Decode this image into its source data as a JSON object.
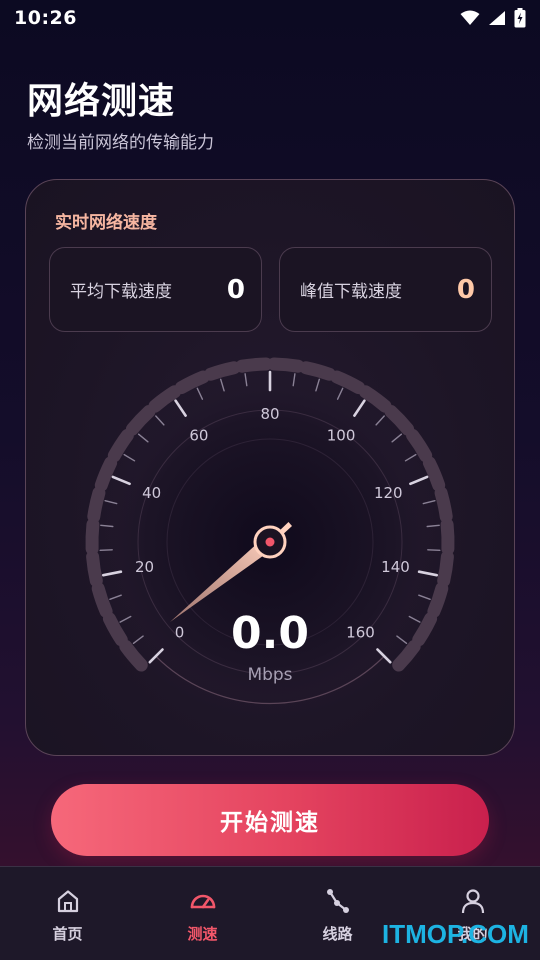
{
  "status_bar": {
    "time": "10:26",
    "icons": [
      "wifi-icon",
      "cell-signal-icon",
      "battery-charging-icon"
    ]
  },
  "header": {
    "title": "网络测速",
    "subtitle": "检测当前网络的传输能力"
  },
  "card": {
    "title": "实时网络速度",
    "avg": {
      "label": "平均下载速度",
      "value": "0"
    },
    "peak": {
      "label": "峰值下载速度",
      "value": "0"
    }
  },
  "gauge": {
    "ticks": [
      "0",
      "20",
      "40",
      "60",
      "80",
      "100",
      "120",
      "140",
      "160"
    ],
    "value": "0.0",
    "unit": "Mbps"
  },
  "action": {
    "start_label": "开始测速"
  },
  "nav": {
    "items": [
      {
        "label": "首页",
        "icon": "home-icon",
        "active": false
      },
      {
        "label": "测速",
        "icon": "speedometer-icon",
        "active": true
      },
      {
        "label": "线路",
        "icon": "route-icon",
        "active": false
      },
      {
        "label": "我的",
        "icon": "user-icon",
        "active": false
      }
    ]
  },
  "watermark": "ITMOP.COM",
  "colors": {
    "accent": "#f2576a",
    "peach": "#f6b6a1",
    "button_start": "#f6687a",
    "button_end": "#c9204d"
  }
}
